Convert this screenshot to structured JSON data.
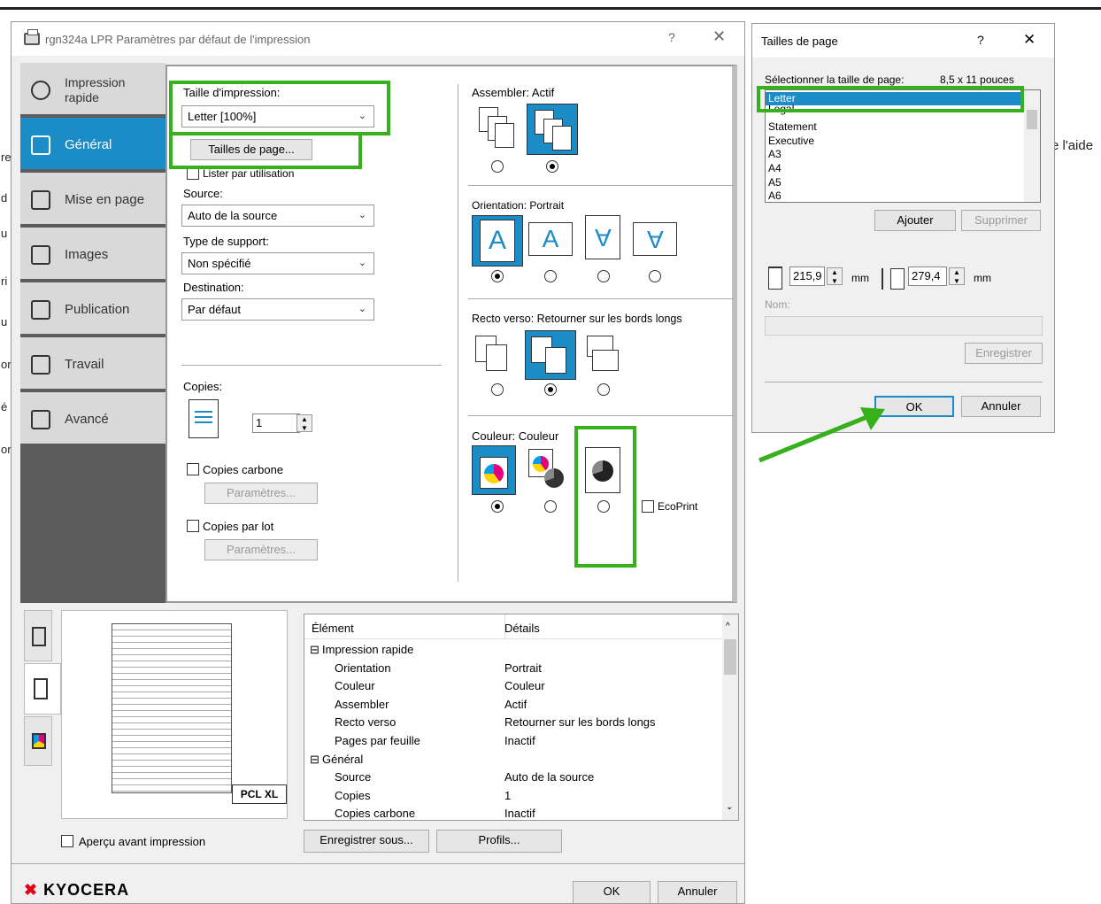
{
  "main_window": {
    "title": "rgn324a LPR Paramètres par défaut de l'impression",
    "help": "?",
    "close": "✕"
  },
  "nav": {
    "items": [
      {
        "label": "Impression rapide"
      },
      {
        "label": "Général"
      },
      {
        "label": "Mise en page"
      },
      {
        "label": "Images"
      },
      {
        "label": "Publication"
      },
      {
        "label": "Travail"
      },
      {
        "label": "Avancé"
      }
    ]
  },
  "general": {
    "print_size_label": "Taille d'impression:",
    "print_size_value": "Letter  [100%]",
    "page_sizes_button": "Tailles de page...",
    "list_by_usage_label": "Lister par utilisation",
    "source_label": "Source:",
    "source_value": "Auto de la source",
    "media_label": "Type de support:",
    "media_value": "Non spécifié",
    "destination_label": "Destination:",
    "destination_value": "Par défaut",
    "copies_label": "Copies:",
    "copies_value": "1",
    "carbon_copies_label": "Copies carbone",
    "carbon_params_button": "Paramètres...",
    "batch_copies_label": "Copies par lot",
    "batch_params_button": "Paramètres...",
    "collate_label": "Assembler:  Actif",
    "orientation_label": "Orientation:  Portrait",
    "duplex_label": "Recto verso:  Retourner sur les bords longs",
    "color_label": "Couleur:  Couleur",
    "ecoprint_label": "EcoPrint"
  },
  "bottom": {
    "pcl_badge": "PCL XL",
    "preview_checkbox": "Aperçu avant impression",
    "save_as_button": "Enregistrer sous...",
    "profiles_button": "Profils...",
    "ok_button": "OK",
    "cancel_button": "Annuler",
    "brand": "KYOCERA"
  },
  "summary_table": {
    "headers": [
      "Élément",
      "Détails"
    ],
    "rows": [
      {
        "item": "Impression rapide",
        "detail": "",
        "group": true
      },
      {
        "item": "Orientation",
        "detail": "Portrait",
        "group": false
      },
      {
        "item": "Couleur",
        "detail": "Couleur",
        "group": false
      },
      {
        "item": "Assembler",
        "detail": "Actif",
        "group": false
      },
      {
        "item": "Recto verso",
        "detail": "Retourner sur les bords longs",
        "group": false
      },
      {
        "item": "Pages par feuille",
        "detail": "Inactif",
        "group": false
      },
      {
        "item": "Général",
        "detail": "",
        "group": true
      },
      {
        "item": "Source",
        "detail": "Auto de la source",
        "group": false
      },
      {
        "item": "Copies",
        "detail": "1",
        "group": false
      },
      {
        "item": "Copies carbone",
        "detail": "Inactif",
        "group": false
      }
    ]
  },
  "page_sizes_dialog": {
    "title": "Tailles de page",
    "help": "?",
    "close": "✕",
    "select_label": "Sélectionner la taille de page:",
    "select_size": "8,5 x 11 pouces",
    "list": [
      "Letter",
      "Legal",
      "Statement",
      "Executive",
      "A3",
      "A4",
      "A5",
      "A6"
    ],
    "selected_index": 0,
    "add_button": "Ajouter",
    "delete_button": "Supprimer",
    "width_value": "215,9",
    "height_value": "279,4",
    "unit": "mm",
    "name_label": "Nom:",
    "save_button": "Enregistrer",
    "ok_button": "OK",
    "cancel_button": "Annuler"
  },
  "background_text": {
    "help_fragment": "e l'aide",
    "left_fragments": [
      "re",
      "d",
      "u",
      "ri",
      "u",
      "or",
      "é",
      "or"
    ]
  },
  "colors": {
    "accent": "#1c8cc6",
    "highlight": "#36b01b",
    "nav_bg": "#d9d9d9"
  }
}
